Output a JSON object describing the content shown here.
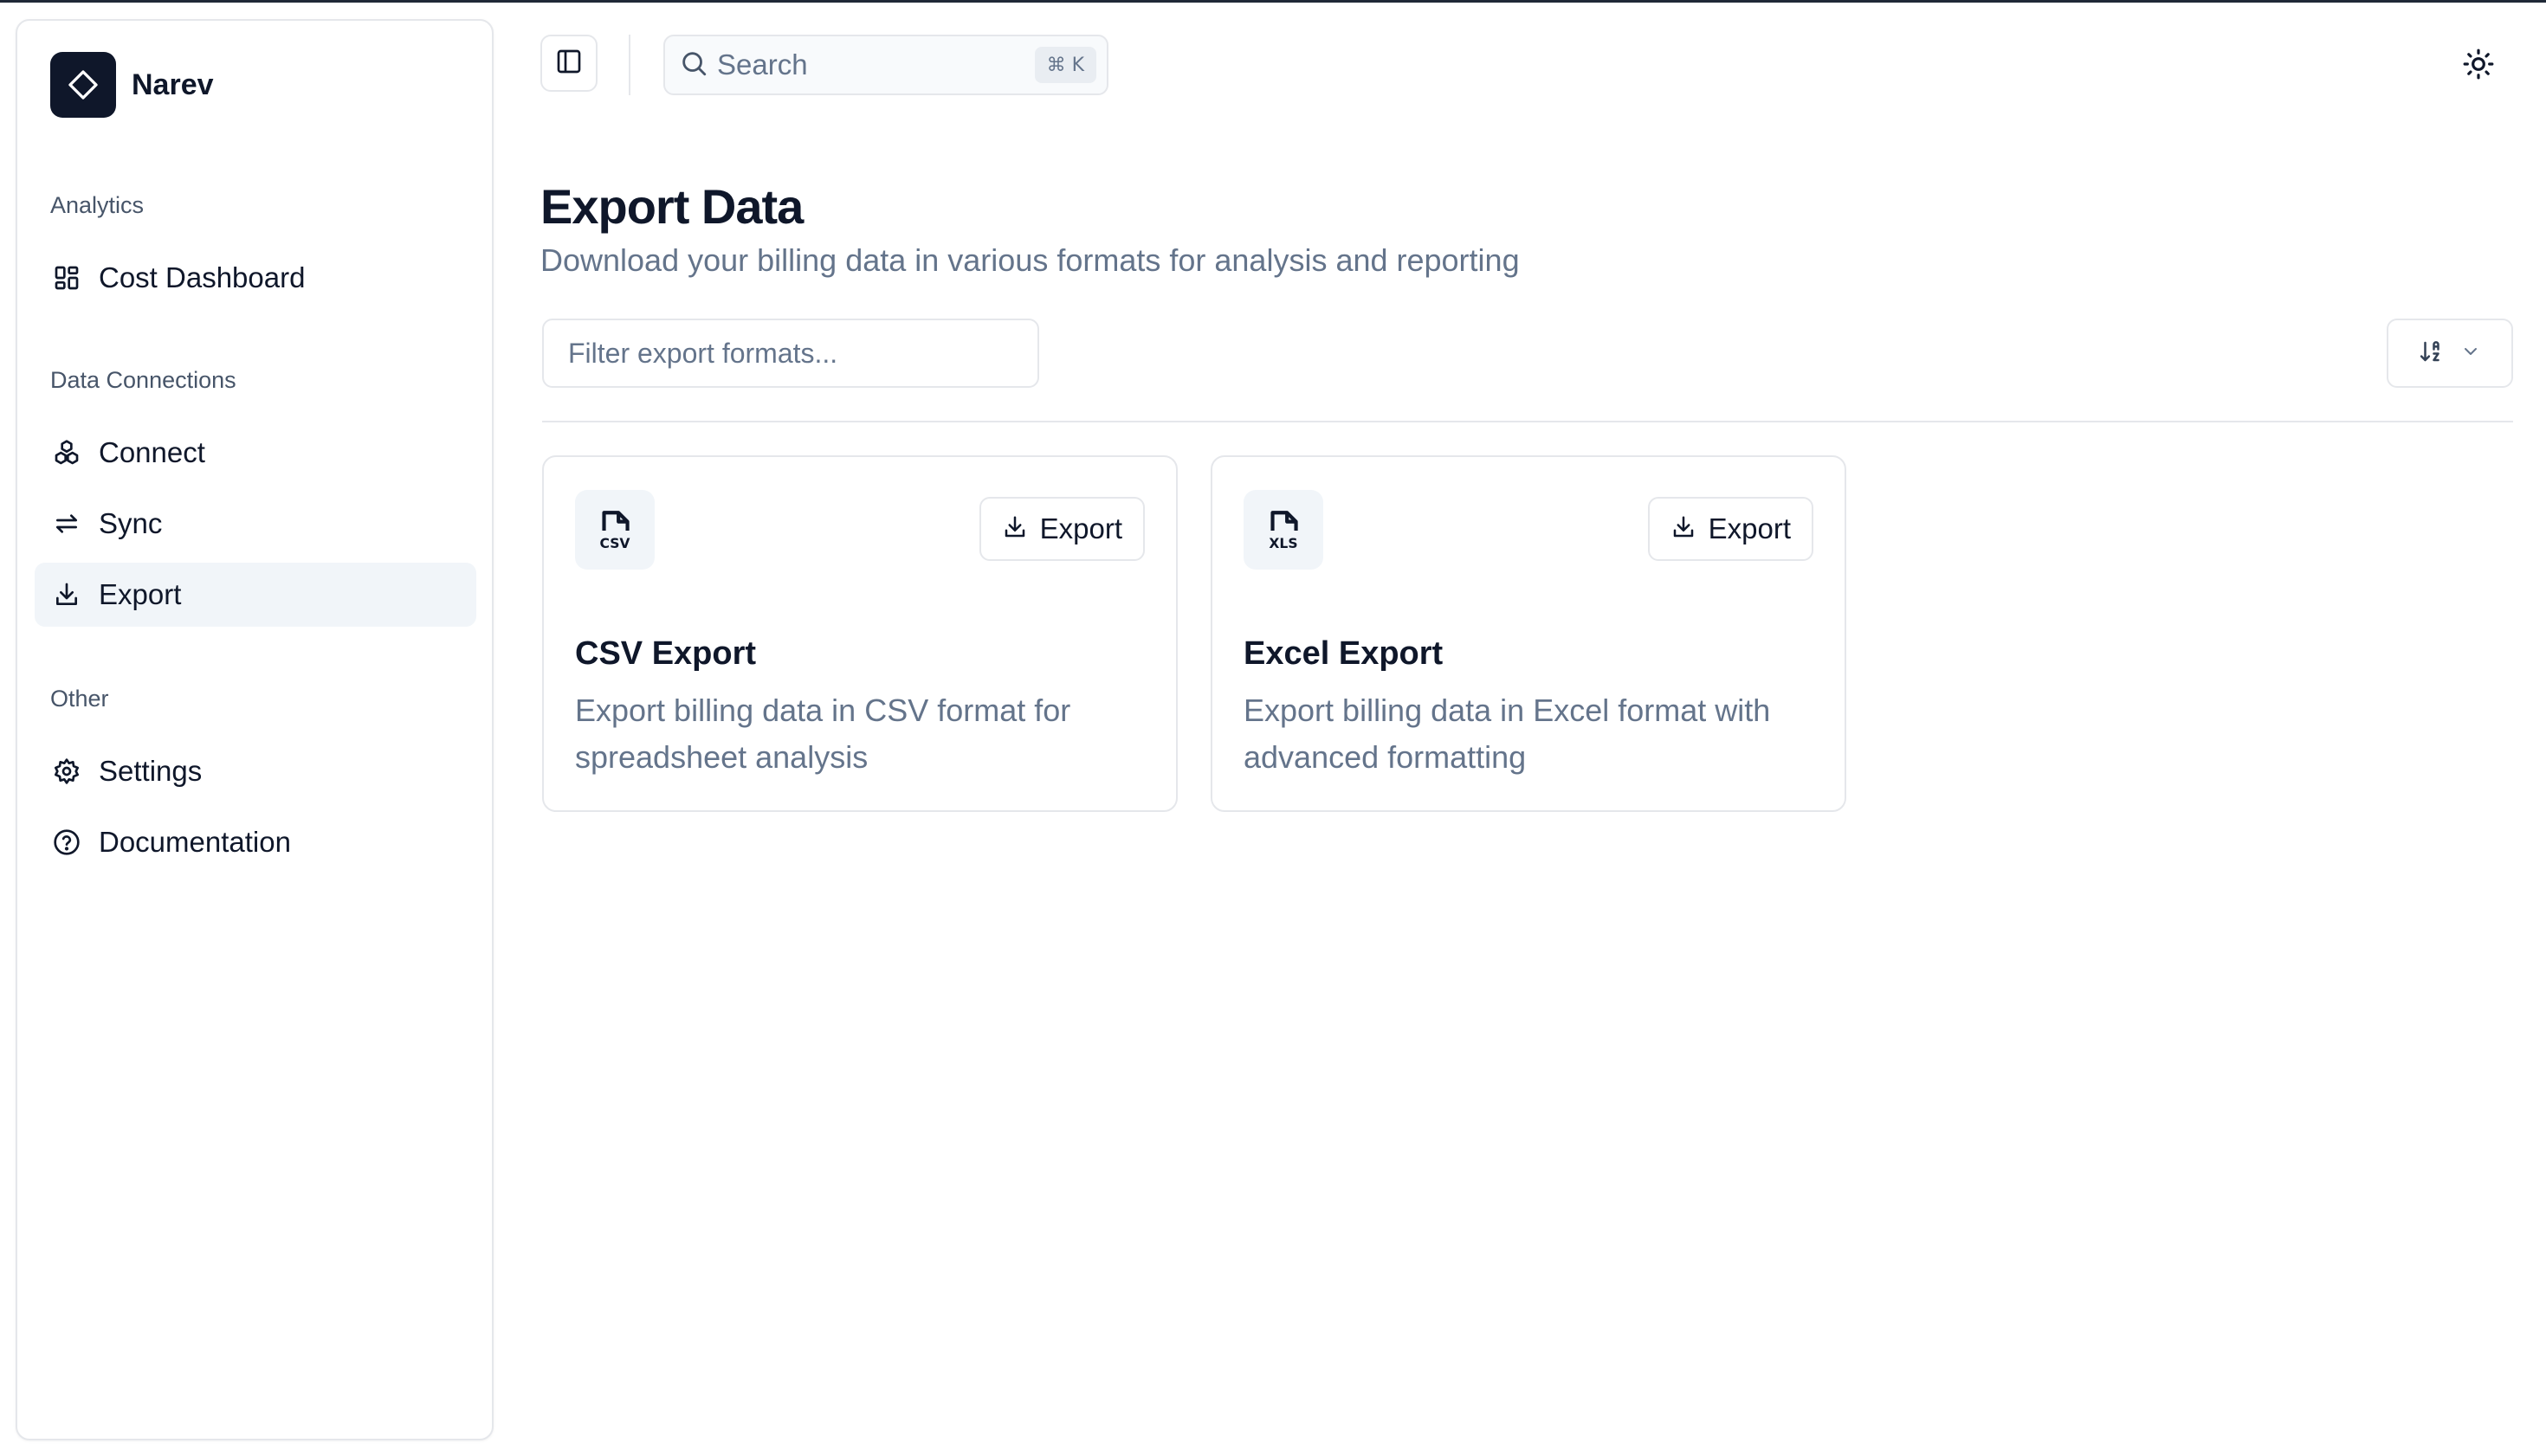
{
  "brand": {
    "name": "Narev"
  },
  "sidebar": {
    "groups": [
      {
        "label": "Analytics",
        "items": [
          {
            "label": "Cost Dashboard",
            "icon": "dashboard-icon"
          }
        ]
      },
      {
        "label": "Data Connections",
        "items": [
          {
            "label": "Connect",
            "icon": "connect-icon"
          },
          {
            "label": "Sync",
            "icon": "sync-arrows-icon"
          },
          {
            "label": "Export",
            "icon": "download-icon",
            "active": true
          }
        ]
      },
      {
        "label": "Other",
        "items": [
          {
            "label": "Settings",
            "icon": "gear-icon"
          },
          {
            "label": "Documentation",
            "icon": "help-circle-icon"
          }
        ]
      }
    ]
  },
  "header": {
    "search_label": "Search",
    "search_shortcut": "⌘ K"
  },
  "main": {
    "title": "Export Data",
    "subtitle": "Download your billing data in various formats for analysis and reporting",
    "filter_placeholder": "Filter export formats...",
    "cards": [
      {
        "icon": "csv-file-icon",
        "button_label": "Export",
        "title": "CSV Export",
        "description": "Export billing data in CSV format for spreadsheet analysis"
      },
      {
        "icon": "xls-file-icon",
        "button_label": "Export",
        "title": "Excel Export",
        "description": "Export billing data in Excel format with advanced formatting"
      }
    ]
  },
  "colors": {
    "primary": "#0f172a",
    "muted": "#64748b",
    "border": "#e5e7eb",
    "active_bg": "#f1f5f9"
  }
}
